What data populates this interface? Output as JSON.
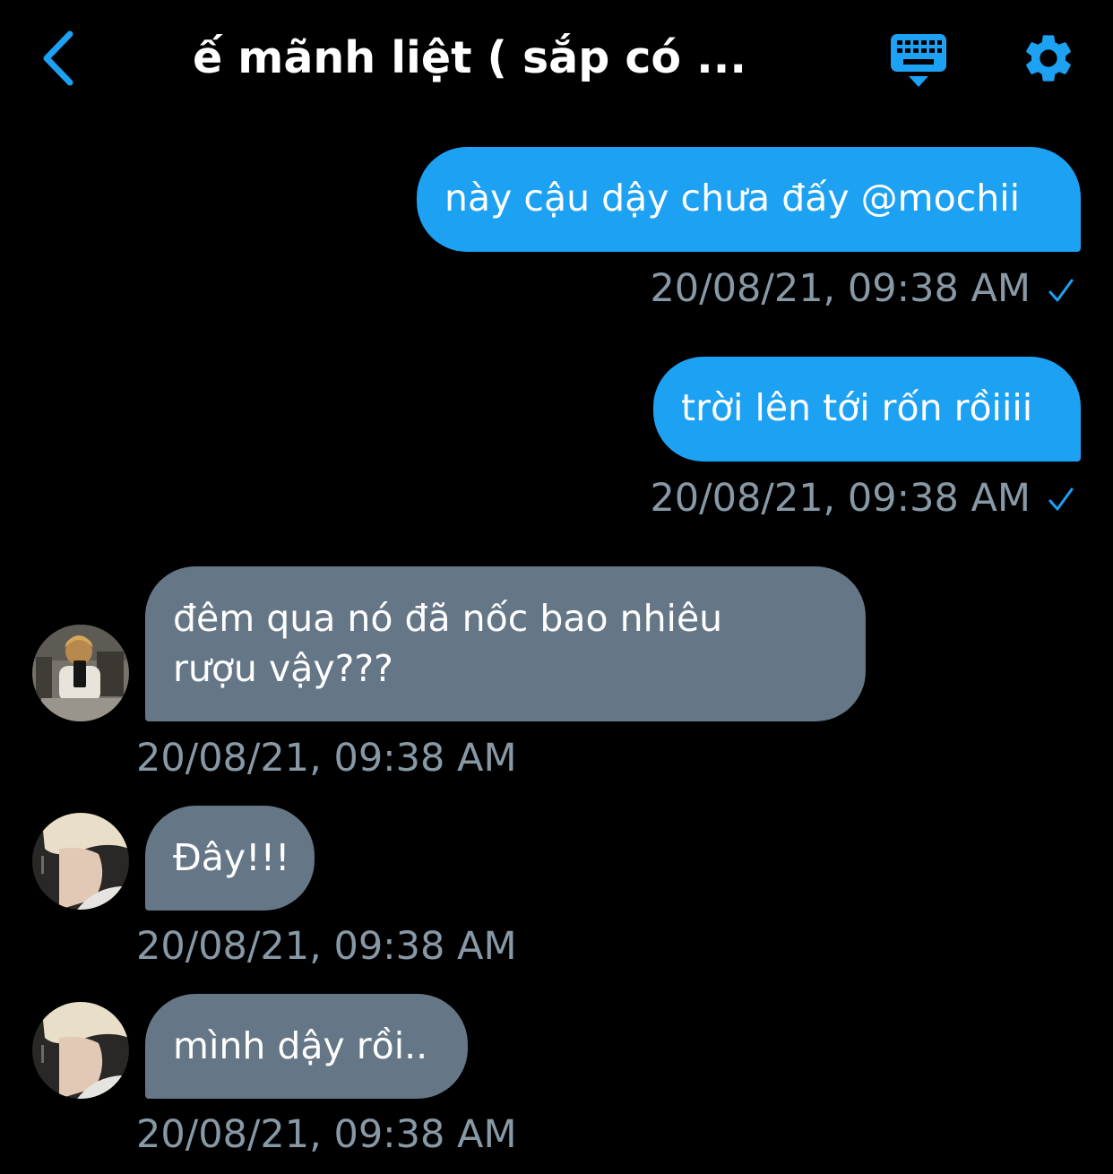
{
  "header": {
    "title": "ế mãnh liệt ( sắp có ..."
  },
  "colors": {
    "accent": "#1da1f2",
    "incoming_bubble": "#657786",
    "timestamp": "#8899a6",
    "background": "#000000"
  },
  "icons": {
    "back": "chevron-left-icon",
    "keyboard": "keyboard-icon",
    "settings": "gear-icon",
    "read": "check-icon"
  },
  "messages": [
    {
      "direction": "outgoing",
      "text": "này cậu dậy chưa đấy @mochii",
      "timestamp": "20/08/21, 09:38 AM"
    },
    {
      "direction": "outgoing",
      "text": "trời lên tới rốn rồiiii",
      "timestamp": "20/08/21, 09:38 AM"
    },
    {
      "direction": "incoming",
      "text": "đêm qua nó đã nốc bao nhiêu rượu vậy???",
      "timestamp": "20/08/21, 09:38 AM"
    },
    {
      "direction": "incoming",
      "text": "Đây!!!",
      "timestamp": "20/08/21, 09:38 AM"
    },
    {
      "direction": "incoming",
      "text": "mình dậy rồi..",
      "timestamp": "20/08/21, 09:38 AM"
    }
  ]
}
